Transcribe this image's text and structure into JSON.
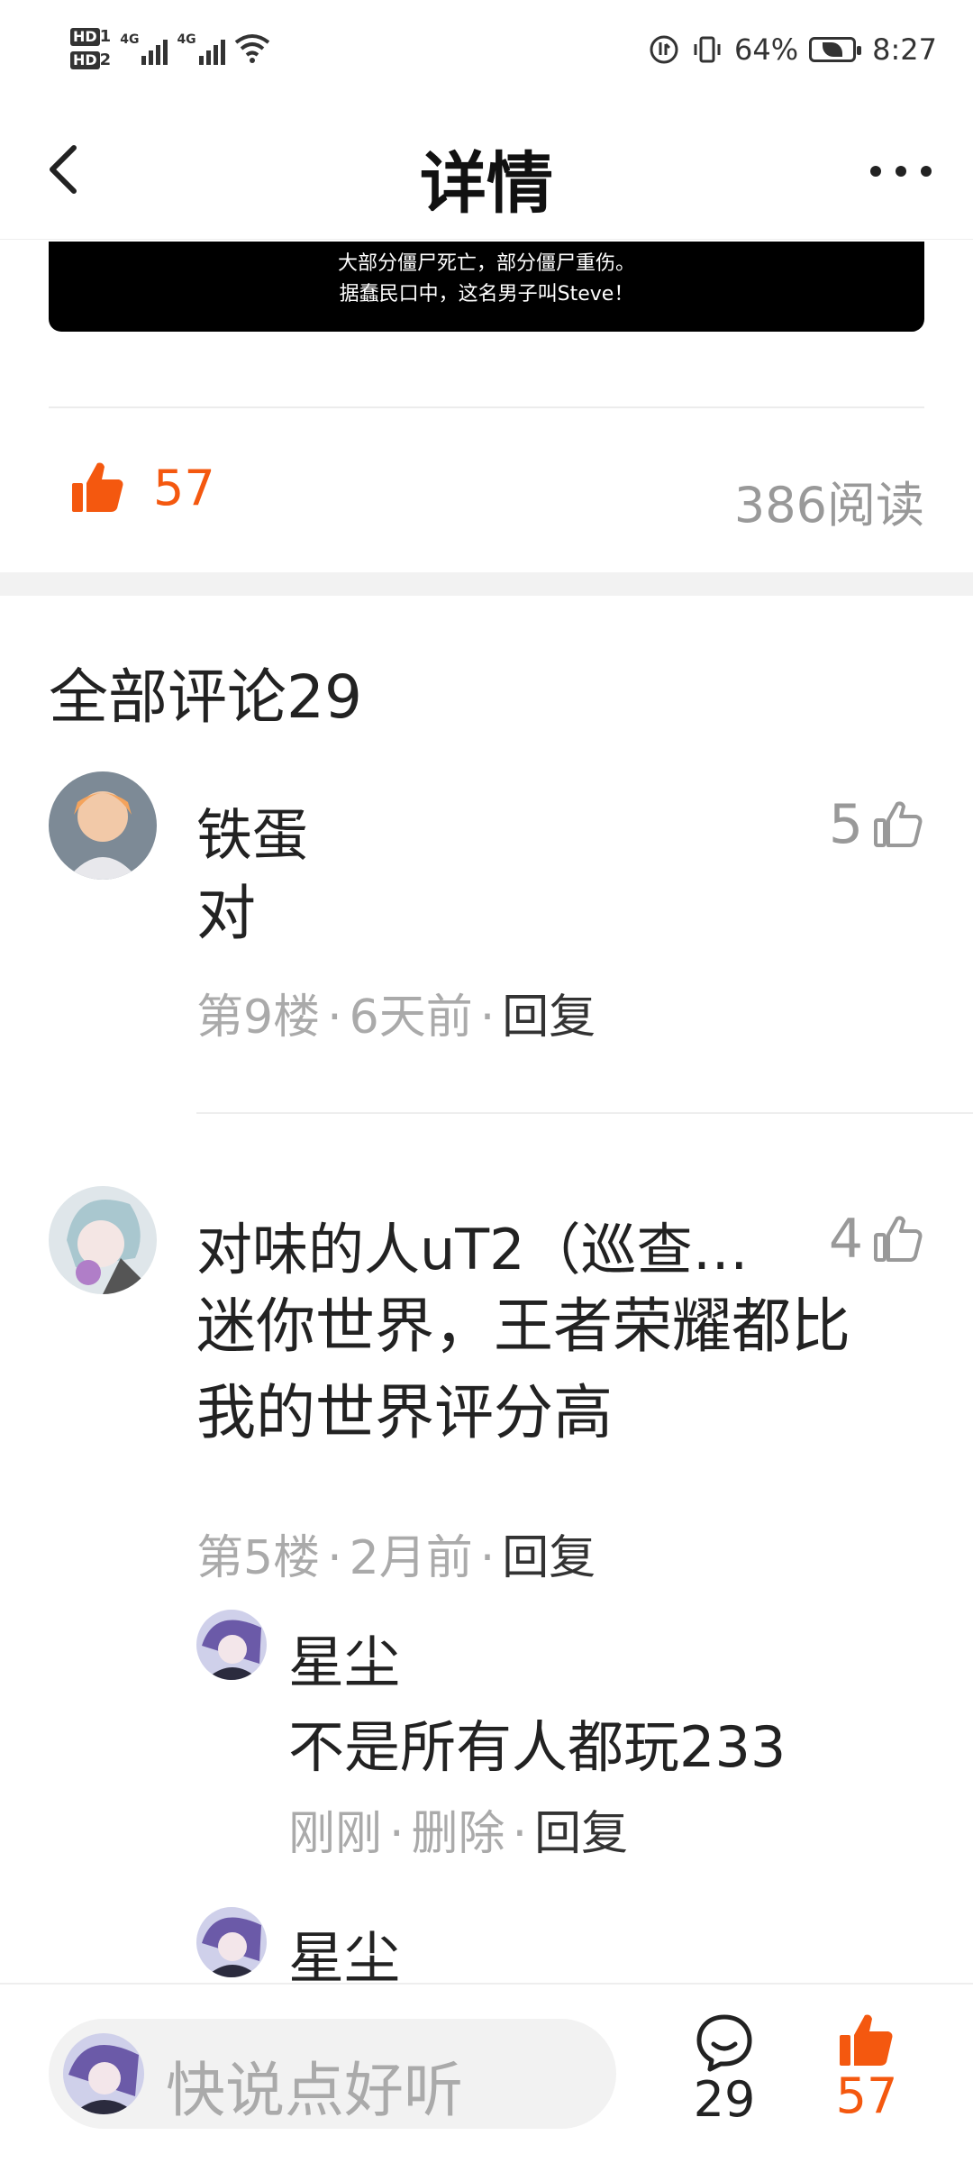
{
  "status_bar": {
    "hd1": "HD",
    "hd1_sub": "1",
    "hd2": "HD",
    "hd2_sub": "2",
    "sim1_label": "4G",
    "sim2_label": "4G",
    "battery_percent": "64%",
    "time": "8:27"
  },
  "nav": {
    "title": "详情"
  },
  "video": {
    "line1": "大部分僵尸死亡，部分僵尸重伤。",
    "line2": "据蠢民口中，这名男子叫Steve！"
  },
  "post_stats": {
    "likes": "57",
    "reads": "386阅读"
  },
  "comments_section": {
    "title": "全部评论29",
    "comments": [
      {
        "name": "铁蛋",
        "likes": "5",
        "text": "对",
        "floor": "第9楼",
        "time": "6天前",
        "reply": "回复"
      },
      {
        "name": "对味的人uT2（巡查…",
        "likes": "4",
        "text": "迷你世界，王者荣耀都比我的世界评分高",
        "floor": "第5楼",
        "time": "2月前",
        "reply": "回复",
        "replies": [
          {
            "name": "星尘",
            "text": "不是所有人都玩233",
            "time": "刚刚",
            "delete": "删除",
            "reply": "回复"
          },
          {
            "name": "星尘"
          }
        ]
      }
    ]
  },
  "bottom_bar": {
    "placeholder": "快说点好听",
    "comment_count": "29",
    "like_count": "57"
  },
  "colors": {
    "accent": "#f4580f",
    "muted": "#999999"
  }
}
